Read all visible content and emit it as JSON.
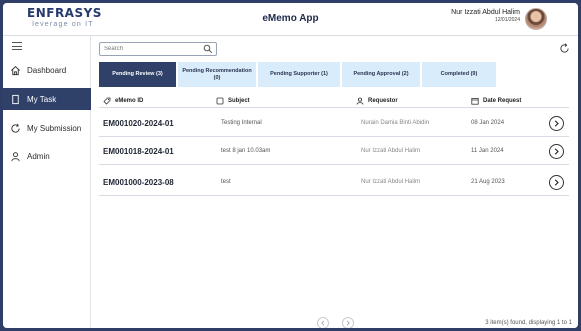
{
  "header": {
    "logo_main": "ENFRASYS",
    "logo_sub": "leverage on IT",
    "app_title": "eMemo App",
    "user_name": "Nur Izzati Abdul Halim",
    "user_date": "12/01/2024"
  },
  "sidebar": {
    "items": [
      {
        "label": "Dashboard",
        "icon": "home-icon"
      },
      {
        "label": "My Task",
        "icon": "bookmark-icon"
      },
      {
        "label": "My Submission",
        "icon": "refresh-icon"
      },
      {
        "label": "Admin",
        "icon": "user-icon"
      }
    ]
  },
  "search": {
    "placeholder": "Search",
    "value": ""
  },
  "tabs": [
    {
      "label": "Pending Review (3)"
    },
    {
      "label": "Pending Recommendation (0)"
    },
    {
      "label": "Pending Supporter (1)"
    },
    {
      "label": "Pending Approval (2)"
    },
    {
      "label": "Completed (9)"
    }
  ],
  "table": {
    "headers": [
      "eMemo ID",
      "Subject",
      "Requestor",
      "Date Request"
    ],
    "rows": [
      [
        "EM001020-2024-01",
        "Testing Internal",
        "Nurain Damia Binti Abidin",
        "08 Jan 2024"
      ],
      [
        "EM001018-2024-01",
        "test 8 jan 10.03am",
        "Nur Izzati Abdul Halim",
        "11 Jan 2024"
      ],
      [
        "EM001000-2023-08",
        "test",
        "Nur Izzati Abdul Halim",
        "21 Aug 2023"
      ]
    ]
  },
  "footer": {
    "summary": "3 item(s) found, displaying 1 to 1"
  },
  "colors": {
    "primary": "#2f4069",
    "tab_inactive": "#d9ecfb",
    "frame": "#2e3e66"
  }
}
